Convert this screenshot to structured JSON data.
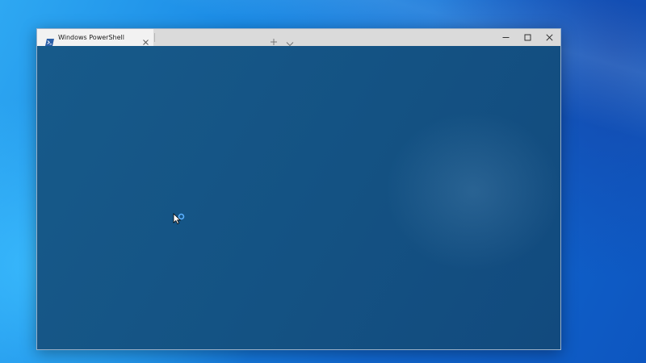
{
  "window": {
    "tab_title": "Windows PowerShell"
  },
  "icons": {
    "tab": "powershell-icon",
    "tab_close": "close-icon",
    "new_tab": "plus-icon",
    "dropdown": "chevron-down-icon",
    "minimize": "minimize-icon",
    "maximize": "maximize-icon",
    "close": "close-icon",
    "cursor": "busy-cursor-icon"
  },
  "colors": {
    "desktop_accent": "#1886e3",
    "titlebar": "#dadada",
    "active_tab": "#f2f2f2",
    "terminal_background": "#145283"
  }
}
